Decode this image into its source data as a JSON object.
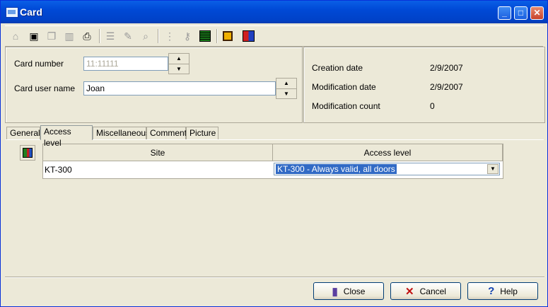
{
  "window": {
    "title": "Card"
  },
  "card": {
    "number_label": "Card number",
    "number_value": "11:11111",
    "user_label": "Card user name",
    "user_value": "Joan"
  },
  "info": {
    "creation_label": "Creation date",
    "creation_value": "2/9/2007",
    "modification_label": "Modification date",
    "modification_value": "2/9/2007",
    "count_label": "Modification count",
    "count_value": "0"
  },
  "tabs": [
    "General",
    "Access level",
    "Miscellaneous",
    "Comment",
    "Picture"
  ],
  "grid": {
    "headers": [
      "Site",
      "Access level"
    ],
    "rows": [
      {
        "site": "KT-300",
        "access": "KT-300 - Always valid, all doors"
      }
    ]
  },
  "buttons": {
    "close": "Close",
    "cancel": "Cancel",
    "help": "Help"
  },
  "icons": {
    "toolbar": [
      "new-icon",
      "save-icon",
      "copy-icon",
      "delete-icon",
      "print-icon",
      "list-icon",
      "attach-icon",
      "find-icon",
      "details-icon",
      "key-icon",
      "grid-icon",
      "film-icon",
      "exit-icon"
    ]
  }
}
